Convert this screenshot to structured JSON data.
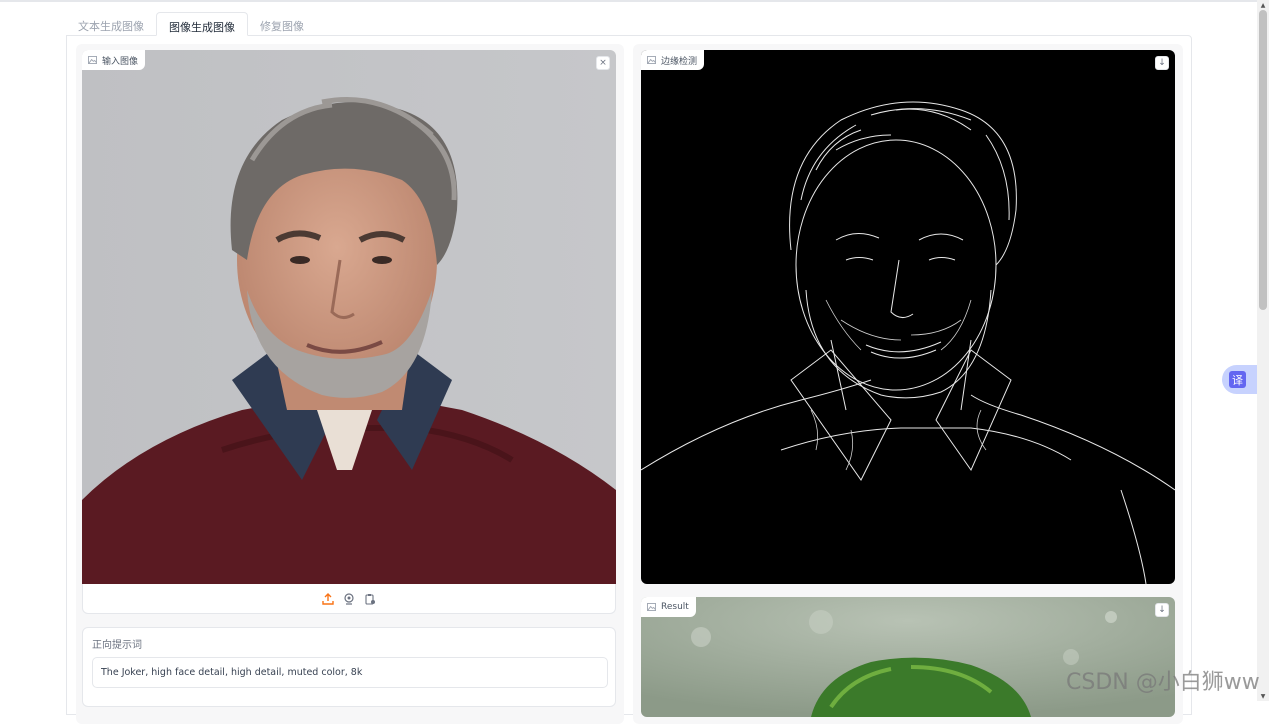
{
  "tabs": [
    {
      "label": "文本生成图像",
      "active": false
    },
    {
      "label": "图像生成图像",
      "active": true
    },
    {
      "label": "修复图像",
      "active": false
    }
  ],
  "input_image": {
    "label": "输入图像",
    "close_symbol": "×"
  },
  "edge_image": {
    "label": "边缘检测",
    "download_symbol": "↓"
  },
  "result_image": {
    "label": "Result",
    "download_symbol": "↓"
  },
  "toolbar_icons": [
    "upload-icon",
    "webcam-icon",
    "clipboard-icon"
  ],
  "prompt": {
    "label": "正向提示词",
    "value": "The Joker, high face detail, high detail, muted color, 8k"
  },
  "translate_button": {
    "label": "译"
  },
  "watermark": "CSDN @小白狮ww",
  "colors": {
    "accent": "#f97316",
    "translate": "#6366f1"
  }
}
